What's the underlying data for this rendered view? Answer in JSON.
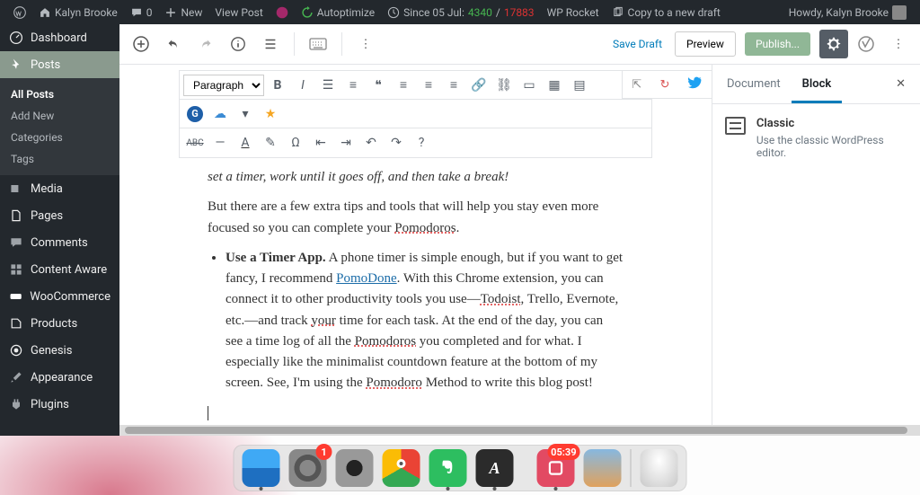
{
  "adminBar": {
    "siteName": "Kalyn Brooke",
    "comments": "0",
    "new": "New",
    "viewPost": "View Post",
    "autoptimize": "Autoptimize",
    "sinceLabel": "Since 05 Jul:",
    "sinceGreen": "4340",
    "sinceSlash": " / ",
    "sinceRed": "17883",
    "wpRocket": "WP Rocket",
    "copyDraft": "Copy to a new draft",
    "howdy": "Howdy, Kalyn Brooke"
  },
  "sidebar": {
    "items": [
      {
        "label": "Dashboard",
        "icon": "dashboard-icon"
      },
      {
        "label": "Posts",
        "icon": "pin-icon",
        "current": true
      },
      {
        "label": "Media",
        "icon": "media-icon"
      },
      {
        "label": "Pages",
        "icon": "page-icon"
      },
      {
        "label": "Comments",
        "icon": "comment-icon"
      },
      {
        "label": "Content Aware",
        "icon": "grid-icon"
      },
      {
        "label": "WooCommerce",
        "icon": "woo-icon"
      },
      {
        "label": "Products",
        "icon": "product-icon"
      },
      {
        "label": "Genesis",
        "icon": "genesis-icon"
      },
      {
        "label": "Appearance",
        "icon": "brush-icon"
      },
      {
        "label": "Plugins",
        "icon": "plugin-icon"
      }
    ],
    "submenu": [
      "All Posts",
      "Add New",
      "Categories",
      "Tags"
    ]
  },
  "editorHeader": {
    "saveDraft": "Save Draft",
    "preview": "Preview",
    "publish": "Publish..."
  },
  "toolbar": {
    "format": "Paragraph"
  },
  "content": {
    "italicLine": "set a timer, work until it goes off, and then take a break!",
    "para2a": "But there are a few extra tips and tools that will help you stay even more focused so you can complete your ",
    "para2Link": "Pomodoros",
    "para2b": ".",
    "li": {
      "bold": "Use a Timer App.",
      "t1": " A phone timer is simple enough, but if you want to get fancy, I recommend ",
      "link1": "PomoDone",
      "t2": ". With this Chrome extension, you can connect it to other productivity tools you use—",
      "sp1": "Todoist",
      "t3": ", Trello, Evernote, etc.—and track ",
      "sp2": "your",
      "t4": " time for each task. At the end of the day, you can see a time log of all the ",
      "sp3": "Pomodoros",
      "t5": " you completed and for what. I especially like the minimalist countdown feature at the bottom of my screen. See, I'm using the ",
      "sp4": "Pomodoro",
      "t6": " Method to write this blog post!"
    }
  },
  "panel": {
    "tabDocument": "Document",
    "tabBlock": "Block",
    "blockTitle": "Classic",
    "blockDesc": "Use the classic WordPress editor."
  },
  "dock": {
    "badge1": "1",
    "timer": "05:39"
  }
}
